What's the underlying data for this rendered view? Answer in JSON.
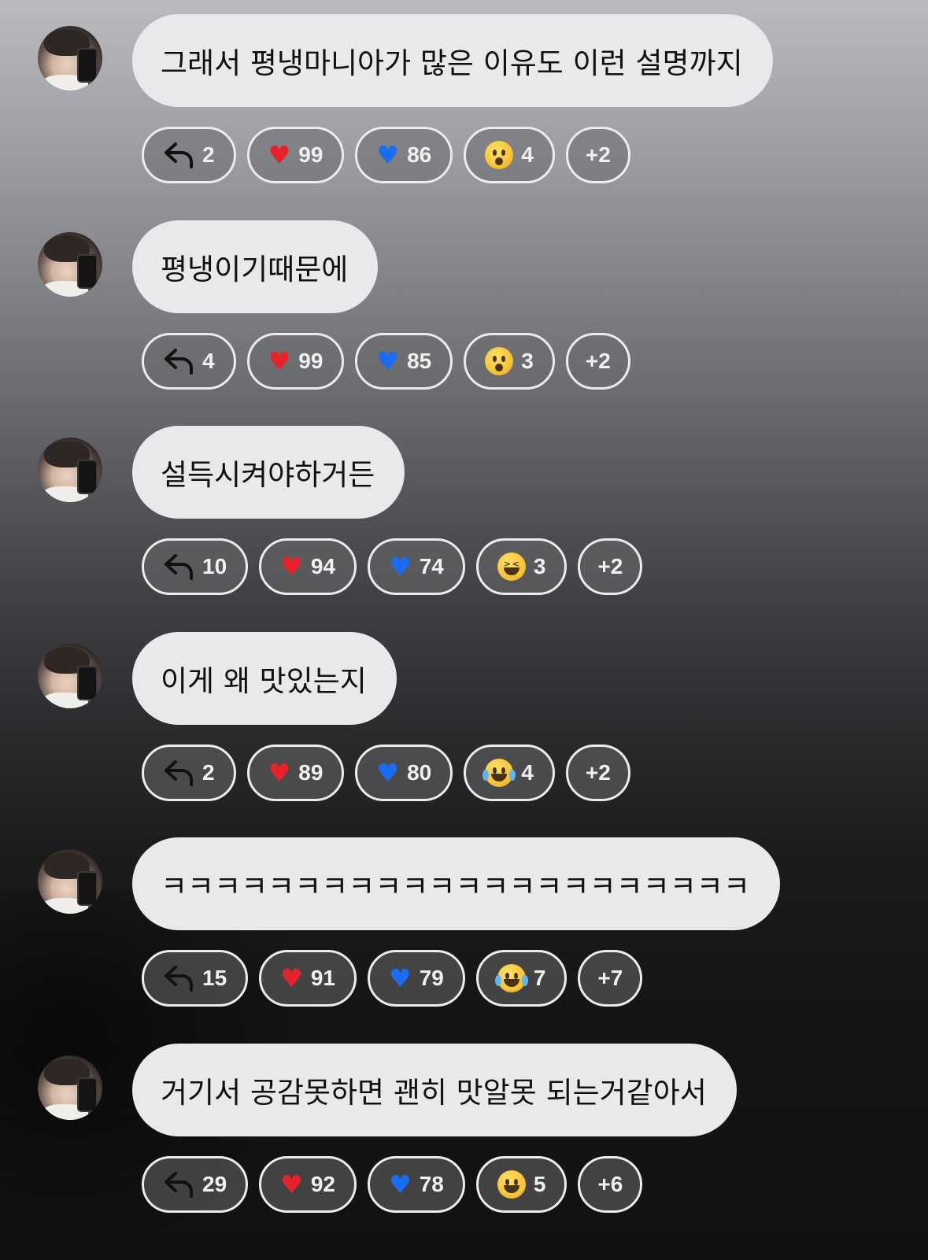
{
  "messages": [
    {
      "text": "그래서 평냉마니아가 많은 이유도 이런 설명까지",
      "replies": "2",
      "reactions": [
        {
          "emoji": "heart-red",
          "count": "99"
        },
        {
          "emoji": "heart-blue",
          "count": "86"
        },
        {
          "emoji": "hushed-face",
          "count": "4"
        }
      ],
      "more": "+2"
    },
    {
      "text": "평냉이기때문에",
      "replies": "4",
      "reactions": [
        {
          "emoji": "heart-red",
          "count": "99"
        },
        {
          "emoji": "heart-blue",
          "count": "85"
        },
        {
          "emoji": "hushed-face",
          "count": "3"
        }
      ],
      "more": "+2"
    },
    {
      "text": "설득시켜야하거든",
      "replies": "10",
      "reactions": [
        {
          "emoji": "heart-red",
          "count": "94"
        },
        {
          "emoji": "heart-blue",
          "count": "74"
        },
        {
          "emoji": "squinting-laughing-face",
          "count": "3"
        }
      ],
      "more": "+2"
    },
    {
      "text": "이게 왜 맛있는지",
      "replies": "2",
      "reactions": [
        {
          "emoji": "heart-red",
          "count": "89"
        },
        {
          "emoji": "heart-blue",
          "count": "80"
        },
        {
          "emoji": "tears-of-joy-face",
          "count": "4"
        }
      ],
      "more": "+2"
    },
    {
      "text": "ㅋㅋㅋㅋㅋㅋㅋㅋㅋㅋㅋㅋㅋㅋㅋㅋㅋㅋㅋㅋㅋㅋ",
      "replies": "15",
      "reactions": [
        {
          "emoji": "heart-red",
          "count": "91"
        },
        {
          "emoji": "heart-blue",
          "count": "79"
        },
        {
          "emoji": "tears-of-joy-face",
          "count": "7"
        }
      ],
      "more": "+7"
    },
    {
      "text": "거기서 공감못하면 괜히 맛알못 되는거같아서",
      "replies": "29",
      "reactions": [
        {
          "emoji": "heart-red",
          "count": "92"
        },
        {
          "emoji": "heart-blue",
          "count": "78"
        },
        {
          "emoji": "grinning-face",
          "count": "5"
        }
      ],
      "more": "+6"
    }
  ]
}
